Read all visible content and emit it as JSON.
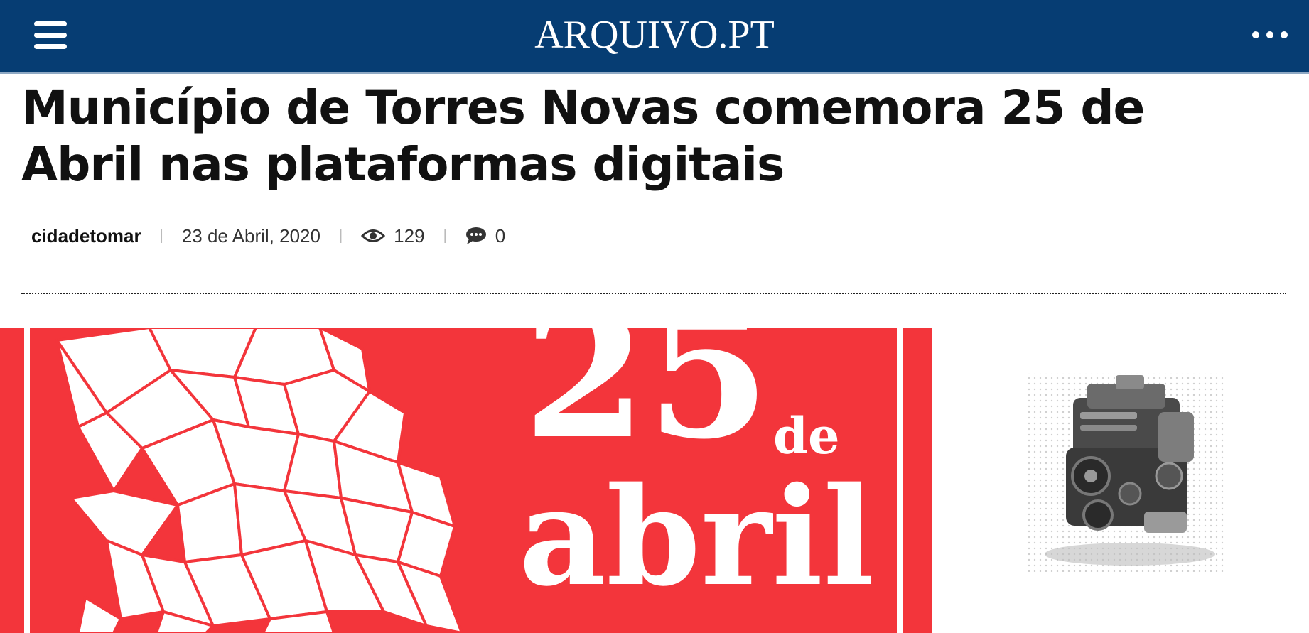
{
  "header": {
    "logo": "ARQUIVO.PT",
    "menu_icon": "hamburger-menu-icon",
    "more_icon": "more-dots-icon",
    "bg_color": "#063d73"
  },
  "article": {
    "title": "Município de Torres Novas comemora 25 de Abril nas plataformas digitais",
    "author": "cidadetomar",
    "date": "23 de Abril, 2020",
    "views": "129",
    "comments": "0"
  },
  "hero_image": {
    "text_number": "25",
    "text_de": "de",
    "text_month": "abril",
    "bg_color": "#f3353b"
  },
  "ad": {
    "image": "car-engine-image"
  }
}
